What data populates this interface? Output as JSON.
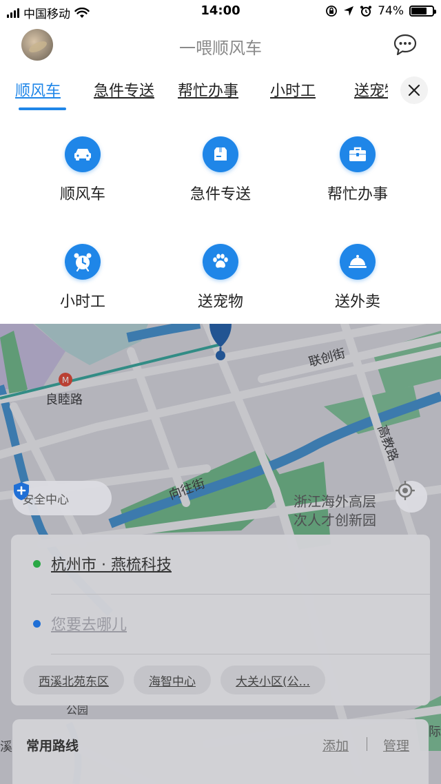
{
  "status_bar": {
    "carrier": "中国移动",
    "time": "14:00",
    "battery_percent": "74%",
    "battery_level": 0.74
  },
  "header": {
    "title": "一喂顺风车"
  },
  "tabs": [
    {
      "label": "顺风车",
      "active": true
    },
    {
      "label": "急件专送",
      "active": false
    },
    {
      "label": "帮忙办事",
      "active": false
    },
    {
      "label": "小时工",
      "active": false
    },
    {
      "label": "送宠物",
      "active": false
    }
  ],
  "services": [
    {
      "label": "顺风车",
      "icon": "car-icon"
    },
    {
      "label": "急件专送",
      "icon": "package-icon"
    },
    {
      "label": "帮忙办事",
      "icon": "briefcase-icon"
    },
    {
      "label": "小时工",
      "icon": "alarm-clock-icon"
    },
    {
      "label": "送宠物",
      "icon": "paw-icon"
    },
    {
      "label": "送外卖",
      "icon": "cloche-icon"
    }
  ],
  "map": {
    "labels": {
      "metro_station": "良睦路",
      "street_1": "联创街",
      "street_2": "高教路",
      "street_3": "向往街",
      "poi": "浙江海外高层次人才创新园",
      "poi_line1": "浙江海外高层",
      "poi_line2": "次人才创新园",
      "park": "公园",
      "edge_1": "溪",
      "edge_2": "际"
    },
    "safety_center": "安全中心"
  },
  "trip": {
    "origin": "杭州市 · 燕梳科技",
    "destination_placeholder": "您要去哪儿",
    "suggestions": [
      "西溪北苑东区",
      "海智中心",
      "大关小区(公..."
    ]
  },
  "routes": {
    "title": "常用路线",
    "add": "添加",
    "manage": "管理"
  },
  "colors": {
    "accent": "#1f86e8",
    "origin_dot": "#2aa845",
    "destination_dot": "#1f6fd6"
  }
}
